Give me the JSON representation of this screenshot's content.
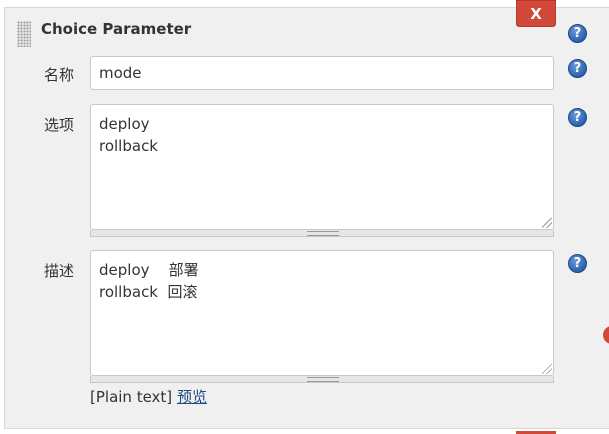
{
  "block": {
    "title": "Choice Parameter",
    "delete_label": "X"
  },
  "help_icon_text": "?",
  "fields": {
    "name": {
      "label": "名称",
      "value": "mode"
    },
    "choices": {
      "label": "选项",
      "value": "deploy\nrollback"
    },
    "description": {
      "label": "描述",
      "value": "deploy    部署\nrollback  回滚"
    }
  },
  "footer": {
    "format": "[Plain text]",
    "preview_label": "预览"
  },
  "colors": {
    "delete_button": "#d24939",
    "help_icon": "#2a62b0",
    "link": "#204a87",
    "panel_background": "#f0f0f0"
  }
}
